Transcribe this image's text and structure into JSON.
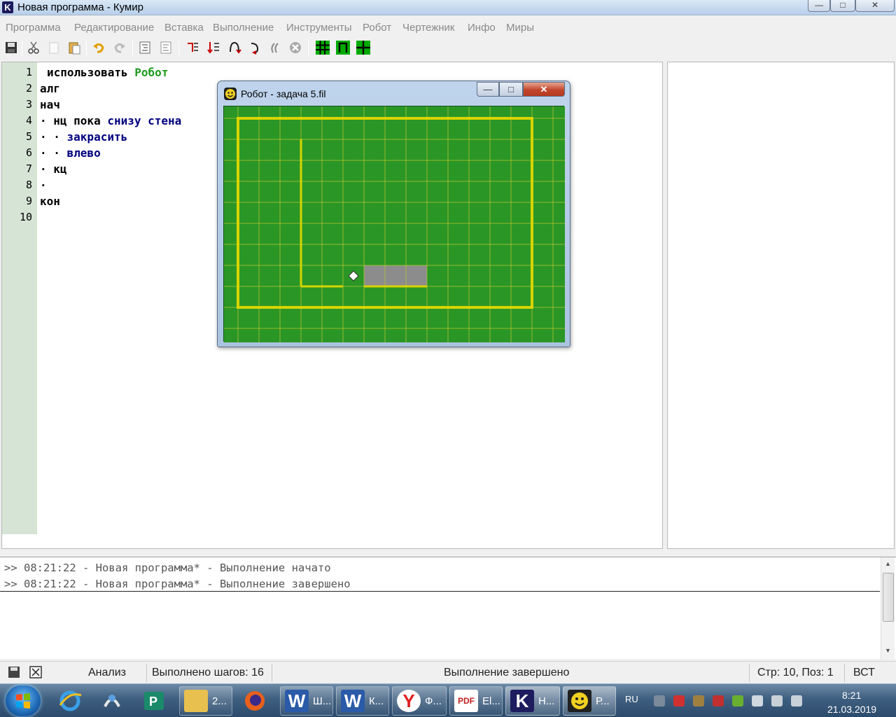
{
  "window": {
    "title": "Новая программа - Кумир",
    "icon_letter": "K",
    "controls": [
      "—",
      "□",
      "✕"
    ]
  },
  "menu": [
    "Программа",
    "Редактирование",
    "Вставка",
    "Выполнение",
    "Инструменты",
    "Робот",
    "Чертежник",
    "Инфо",
    "Миры"
  ],
  "toolbar": {
    "icons": [
      "save-icon",
      "cut-icon",
      "copy-icon",
      "paste-icon",
      "undo-icon",
      "redo-icon",
      "indent-icon",
      "unindent-icon",
      "run-icon",
      "step-icon",
      "step-into-icon",
      "step-out-icon",
      "step-over-icon",
      "stop-icon",
      "robot-grid-icon",
      "draw-icon",
      "field-icon"
    ]
  },
  "editor": {
    "line_numbers": [
      "1",
      "2",
      "3",
      "4",
      "5",
      "6",
      "7",
      "8",
      "9",
      "10"
    ],
    "lines": [
      [
        {
          "t": "использовать ",
          "c": "kw"
        },
        {
          "t": "Робот",
          "c": "mod"
        }
      ],
      [
        {
          "t": "алг",
          "c": "kw"
        }
      ],
      [
        {
          "t": "нач",
          "c": "kw"
        }
      ],
      [
        {
          "t": "· ",
          "c": "dot"
        },
        {
          "t": "нц пока ",
          "c": "kw"
        },
        {
          "t": "снизу стена",
          "c": "cmd"
        }
      ],
      [
        {
          "t": "· · ",
          "c": "dot"
        },
        {
          "t": "закрасить",
          "c": "cmd"
        }
      ],
      [
        {
          "t": "· · ",
          "c": "dot"
        },
        {
          "t": "влево",
          "c": "cmd"
        }
      ],
      [
        {
          "t": "· ",
          "c": "dot"
        },
        {
          "t": "кц",
          "c": "kw"
        }
      ],
      [
        {
          "t": "·",
          "c": "dot"
        }
      ],
      [
        {
          "t": "кон",
          "c": "kw"
        }
      ],
      []
    ],
    "colors": {
      "keyword": "#000000",
      "module": "#1e9b1e",
      "command": "#00007f",
      "gutter": "#d6e4d6"
    }
  },
  "robot_window": {
    "title": "Робот - задача 5.fil",
    "controls": [
      "—",
      "□",
      "✕"
    ],
    "field": {
      "columns": 16,
      "rows": 11,
      "field_color": "#2a9626",
      "wall_color": "#d8d400",
      "painted_color": "#8c8c8c",
      "robot_cell": [
        6,
        8
      ],
      "painted_cells": [
        [
          7,
          8
        ],
        [
          8,
          8
        ],
        [
          9,
          8
        ]
      ],
      "outer_wall": {
        "from": [
          1,
          0
        ],
        "to": [
          15,
          10
        ]
      },
      "walls": [
        {
          "side": "left",
          "col": 4,
          "rows": [
            2,
            3,
            4,
            5,
            6,
            7,
            8
          ]
        },
        {
          "side": "bottom",
          "row": 8,
          "cols": [
            4,
            5,
            7,
            8,
            9
          ]
        }
      ]
    }
  },
  "console": {
    "lines": [
      ">> 08:21:22 - Новая программа* - Выполнение начато",
      ">> 08:21:22 - Новая программа* - Выполнение завершено"
    ]
  },
  "status": {
    "mode": "Анализ",
    "steps": "Выполнено шагов: 16",
    "message": "Выполнение завершено",
    "position": "Стр: 10, Поз: 1",
    "insert_mode": "ВСТ"
  },
  "taskbar": {
    "tasks": [
      {
        "label": "2...",
        "icon": "folder-icon",
        "color": "#e8c050"
      },
      {
        "label": "Ш...",
        "icon": "word-icon",
        "color": "#2a5aa8"
      },
      {
        "label": "К...",
        "icon": "word-icon",
        "color": "#2a5aa8"
      },
      {
        "label": "Ф...",
        "icon": "yandex-icon",
        "color": "#e02020"
      },
      {
        "label": "El...",
        "icon": "pdf-icon",
        "color": "#c02020"
      },
      {
        "label": "Н...",
        "icon": "kumir-icon",
        "color": "#1c1c5e"
      },
      {
        "label": "Р...",
        "icon": "robot-icon",
        "color": "#202020"
      }
    ],
    "language": "RU",
    "time": "8:21",
    "date": "21.03.2019"
  }
}
